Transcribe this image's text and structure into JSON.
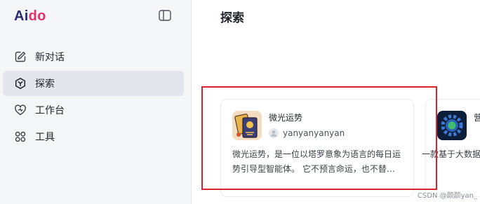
{
  "brand": {
    "part1": "Ai",
    "part2": "do"
  },
  "sidebar": {
    "items": [
      {
        "label": "新对话",
        "icon": "edit-icon",
        "active": false
      },
      {
        "label": "探索",
        "icon": "explore-icon",
        "active": true
      },
      {
        "label": "工作台",
        "icon": "heart-icon",
        "active": false
      },
      {
        "label": "工具",
        "icon": "grid-icon",
        "active": false
      }
    ]
  },
  "main": {
    "title": "探索",
    "cards": [
      {
        "name": "微光运势",
        "author": "yanyanyanyan",
        "description": "微光运势，是一位以塔罗意象为语言的每日运势引导型智能体。 它不预言命运，也不替…"
      },
      {
        "name": "营",
        "author": "",
        "description": "一款基于大数据分析项目目标"
      }
    ]
  },
  "watermark": "CSDN @颜颜yan_",
  "colors": {
    "highlight": "#d9232d",
    "brand_dark": "#2b2b6e",
    "brand_pink": "#e0316b",
    "active_bg": "#e3e6ec"
  }
}
